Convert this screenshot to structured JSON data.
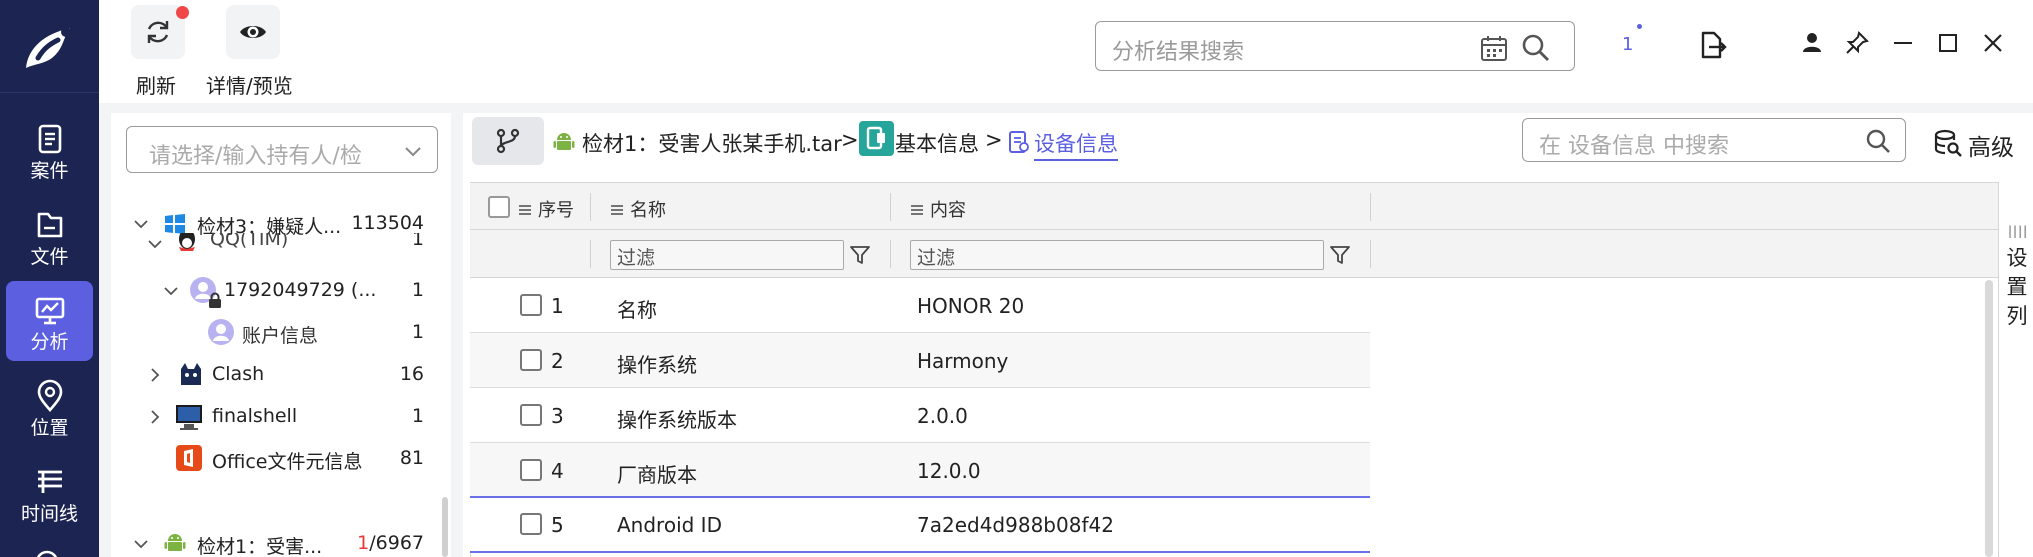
{
  "nav": {
    "items": [
      {
        "label": "案件",
        "icon": "case-icon"
      },
      {
        "label": "文件",
        "icon": "file-icon"
      },
      {
        "label": "分析",
        "icon": "analysis-icon",
        "active": true
      },
      {
        "label": "位置",
        "icon": "location-icon"
      },
      {
        "label": "时间线",
        "icon": "timeline-icon"
      }
    ]
  },
  "toolbar": {
    "refresh_label": "刷新",
    "preview_label": "详情/预览",
    "search_placeholder": "分析结果搜索",
    "notification_count": "1"
  },
  "tree": {
    "holder_placeholder": "请选择/输入持有人/检",
    "rows": [
      {
        "label": "检材3：嫌疑人...",
        "count": "113504"
      },
      {
        "label": "QQ(TIM)",
        "count": "1"
      },
      {
        "label": "1792049729 (...",
        "count": "1"
      },
      {
        "label": "账户信息",
        "count": "1"
      },
      {
        "label": "Clash",
        "count": "16"
      },
      {
        "label": "finalshell",
        "count": "1"
      },
      {
        "label": "Office文件元信息",
        "count": "81"
      }
    ],
    "bottom_row": {
      "label": "检材1：受害...",
      "count_highlight": "1",
      "count_rest": "/6967"
    }
  },
  "breadcrumb": {
    "items": [
      {
        "label": "检材1：受害人张某手机.tar"
      },
      {
        "label": "基本信息"
      },
      {
        "label": "设备信息"
      }
    ],
    "separator": ">"
  },
  "table_search": {
    "placeholder": "在 设备信息 中搜索"
  },
  "advanced_label": "高级",
  "table": {
    "columns": [
      "序号",
      "名称",
      "内容"
    ],
    "filter_placeholder": "过滤",
    "rows": [
      {
        "no": "1",
        "name": "名称",
        "value": "HONOR 20"
      },
      {
        "no": "2",
        "name": "操作系统",
        "value": "Harmony"
      },
      {
        "no": "3",
        "name": "操作系统版本",
        "value": "2.0.0"
      },
      {
        "no": "4",
        "name": "厂商版本",
        "value": "12.0.0"
      },
      {
        "no": "5",
        "name": "Android ID",
        "value": "7a2ed4d988b08f42"
      }
    ]
  },
  "set_columns": {
    "grip": "||||",
    "label": "设置列"
  },
  "colors": {
    "nav_bg": "#1c2451",
    "accent": "#5b5fe0",
    "red": "#f04848"
  }
}
